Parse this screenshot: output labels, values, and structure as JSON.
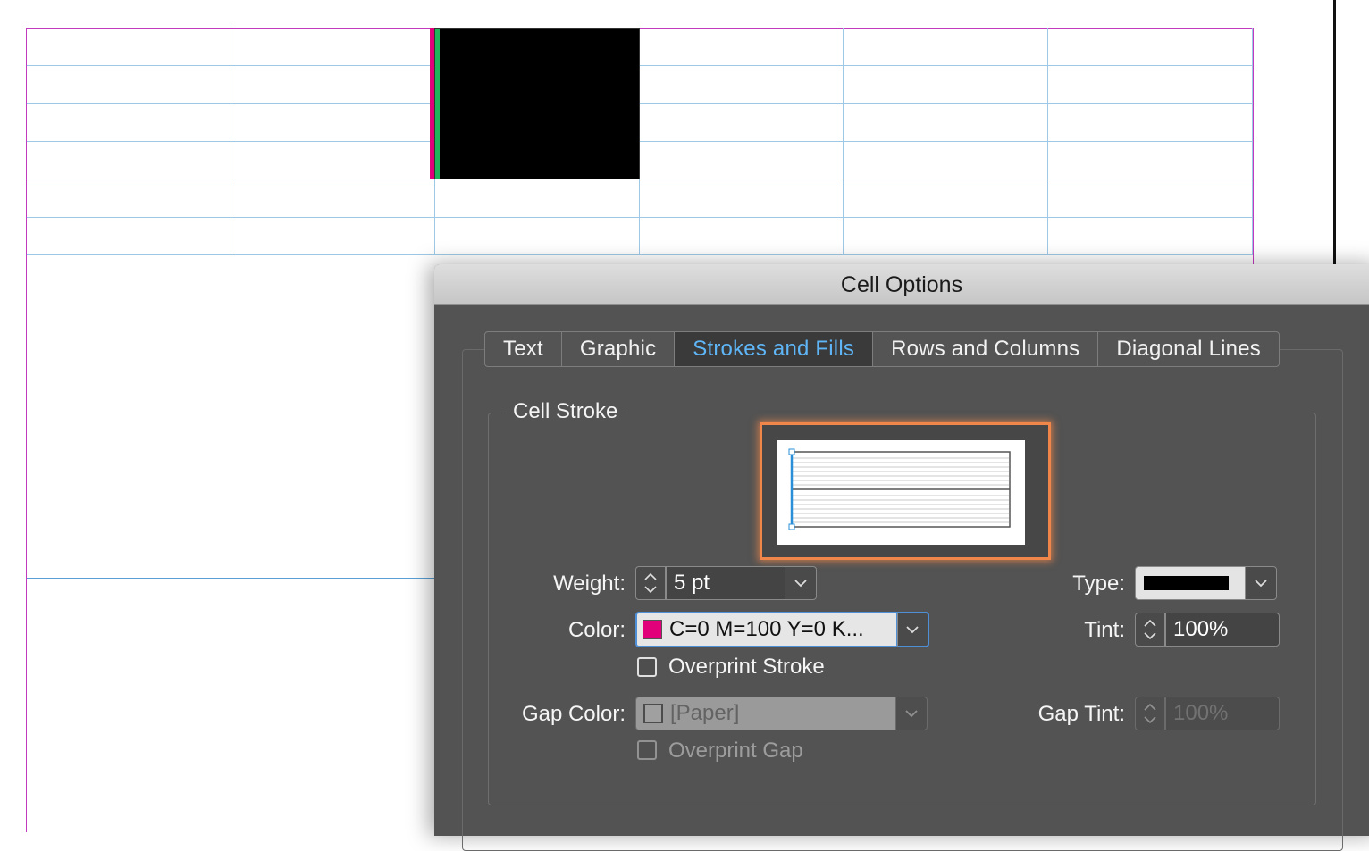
{
  "dialog": {
    "title": "Cell Options",
    "tabs": [
      {
        "label": "Text"
      },
      {
        "label": "Graphic"
      },
      {
        "label": "Strokes and Fills",
        "active": true
      },
      {
        "label": "Rows and Columns"
      },
      {
        "label": "Diagonal Lines"
      }
    ],
    "cell_stroke": {
      "group_label": "Cell Stroke",
      "weight_label": "Weight:",
      "weight_value": "5 pt",
      "type_label": "Type:",
      "color_label": "Color:",
      "color_value": "C=0 M=100 Y=0 K...",
      "color_swatch": "#e2007a",
      "tint_label": "Tint:",
      "tint_value": "100%",
      "overprint_stroke_label": "Overprint Stroke",
      "overprint_stroke_checked": false,
      "gap_color_label": "Gap Color:",
      "gap_color_value": "[Paper]",
      "gap_tint_label": "Gap Tint:",
      "gap_tint_value": "100%",
      "overprint_gap_label": "Overprint Gap",
      "overprint_gap_checked": false
    }
  },
  "colors": {
    "accent_tab": "#5fb6f7",
    "preview_highlight": "#f0864a",
    "selected_cell_fill": "#000000",
    "stroke_magenta": "#e2007a",
    "selection_green": "#1fb45a",
    "margin_guide": "#c23ac0",
    "table_grid": "#9ec9e6"
  }
}
